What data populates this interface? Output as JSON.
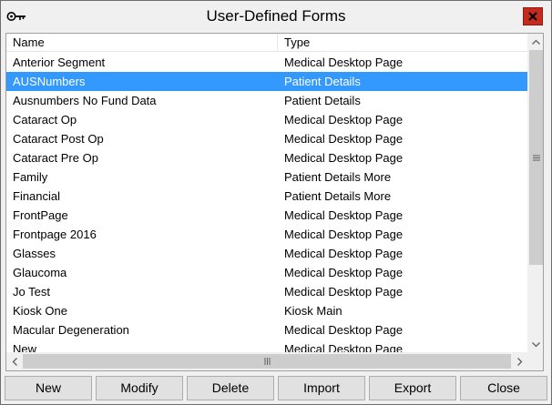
{
  "window": {
    "title": "User-Defined Forms",
    "close_glyph": "✕",
    "icon": "key-icon"
  },
  "list": {
    "columns": {
      "name": "Name",
      "type": "Type"
    },
    "selected_index": 1,
    "rows": [
      {
        "name": "Anterior Segment",
        "type": "Medical Desktop Page"
      },
      {
        "name": "AUSNumbers",
        "type": "Patient Details"
      },
      {
        "name": "Ausnumbers No Fund Data",
        "type": "Patient Details"
      },
      {
        "name": "Cataract Op",
        "type": "Medical Desktop Page"
      },
      {
        "name": "Cataract Post Op",
        "type": "Medical Desktop Page"
      },
      {
        "name": "Cataract Pre Op",
        "type": "Medical Desktop Page"
      },
      {
        "name": "Family",
        "type": "Patient Details More"
      },
      {
        "name": "Financial",
        "type": "Patient Details More"
      },
      {
        "name": "FrontPage",
        "type": "Medical Desktop Page"
      },
      {
        "name": "Frontpage 2016",
        "type": "Medical Desktop Page"
      },
      {
        "name": "Glasses",
        "type": "Medical Desktop Page"
      },
      {
        "name": "Glaucoma",
        "type": "Medical Desktop Page"
      },
      {
        "name": "Jo Test",
        "type": "Medical Desktop Page"
      },
      {
        "name": "Kiosk One",
        "type": "Kiosk Main"
      },
      {
        "name": "Macular Degeneration",
        "type": "Medical Desktop Page"
      },
      {
        "name": "New",
        "type": "Medical Desktop Page"
      }
    ]
  },
  "buttons": {
    "new": "New",
    "modify": "Modify",
    "delete": "Delete",
    "import": "Import",
    "export": "Export",
    "close": "Close"
  },
  "colors": {
    "selection": "#3399ff",
    "close_button": "#c42b1c"
  }
}
